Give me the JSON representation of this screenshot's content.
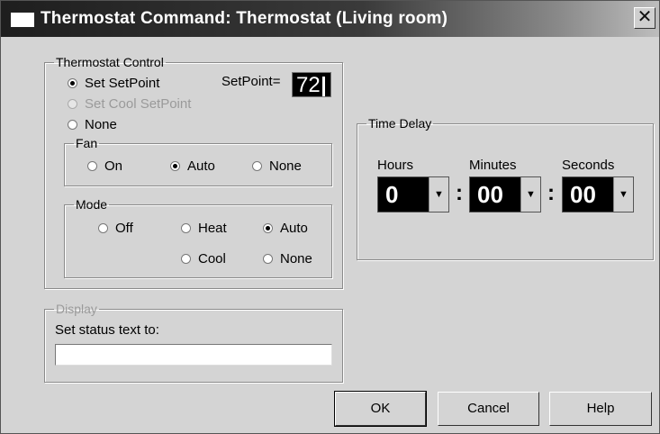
{
  "window": {
    "title": "Thermostat Command: Thermostat (Living room)",
    "close_glyph": "✕"
  },
  "thermostat_control": {
    "legend": "Thermostat Control",
    "options": [
      {
        "label": "Set SetPoint",
        "selected": true,
        "enabled": true
      },
      {
        "label": "Set Cool SetPoint",
        "selected": false,
        "enabled": false
      },
      {
        "label": "None",
        "selected": false,
        "enabled": true
      }
    ],
    "setpoint_label": "SetPoint=",
    "setpoint_value": "72"
  },
  "fan": {
    "legend": "Fan",
    "options": [
      {
        "label": "On",
        "selected": false
      },
      {
        "label": "Auto",
        "selected": true
      },
      {
        "label": "None",
        "selected": false
      }
    ]
  },
  "mode": {
    "legend": "Mode",
    "options": [
      {
        "label": "Off",
        "selected": false
      },
      {
        "label": "Heat",
        "selected": false
      },
      {
        "label": "Auto",
        "selected": true
      },
      {
        "label": "Cool",
        "selected": false
      },
      {
        "label": "None",
        "selected": false
      }
    ]
  },
  "display": {
    "legend": "Display",
    "status_label": "Set status text to:",
    "status_value": ""
  },
  "time_delay": {
    "legend": "Time Delay",
    "hours_label": "Hours",
    "hours_value": "0",
    "minutes_label": "Minutes",
    "minutes_value": "00",
    "seconds_label": "Seconds",
    "seconds_value": "00",
    "separator": ":",
    "dropdown_glyph": "▼"
  },
  "buttons": {
    "ok": "OK",
    "cancel": "Cancel",
    "help": "Help"
  }
}
